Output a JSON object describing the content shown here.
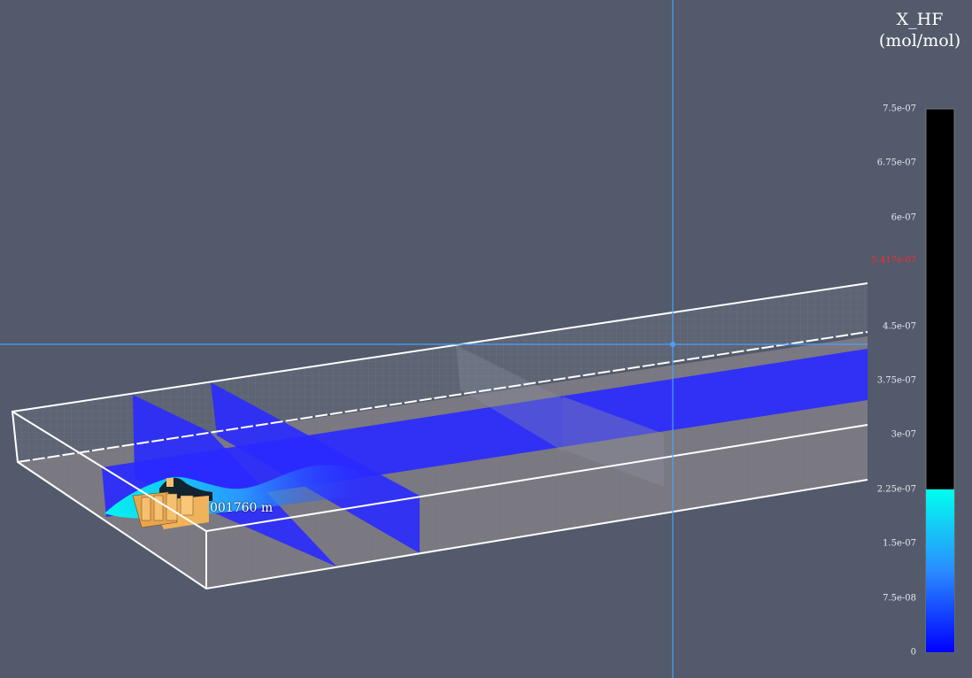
{
  "legend": {
    "variable": "X_HF",
    "unit": "(mol/mol)",
    "ticks": [
      {
        "label": "7.5e-07",
        "value": 7.5e-07
      },
      {
        "label": "6.75e-07",
        "value": 6.75e-07
      },
      {
        "label": "6e-07",
        "value": 6e-07
      },
      {
        "label": "4.5e-07",
        "value": 4.5e-07
      },
      {
        "label": "3.75e-07",
        "value": 3.75e-07
      },
      {
        "label": "3e-07",
        "value": 3e-07
      },
      {
        "label": "2.25e-07",
        "value": 2.25e-07
      },
      {
        "label": "1.5e-07",
        "value": 1.5e-07
      },
      {
        "label": "7.5e-08",
        "value": 7.5e-08
      },
      {
        "label": "0",
        "value": 0
      }
    ],
    "marker": {
      "label": "5.417e-07",
      "value": 5.417e-07
    },
    "range": [
      0,
      7.5e-07
    ],
    "color_ramp_max_value": 2.25e-07,
    "colors": {
      "low": "#0000ff",
      "mid": "#2a8cff",
      "high": "#00ffee",
      "saturated": "#000000",
      "marker": "#ff2a2a"
    }
  },
  "scene": {
    "distance_label": "001760 m",
    "crosshair_color": "#4aa0ff",
    "plane_color": "#2a2aff",
    "background": "#525a6b"
  }
}
